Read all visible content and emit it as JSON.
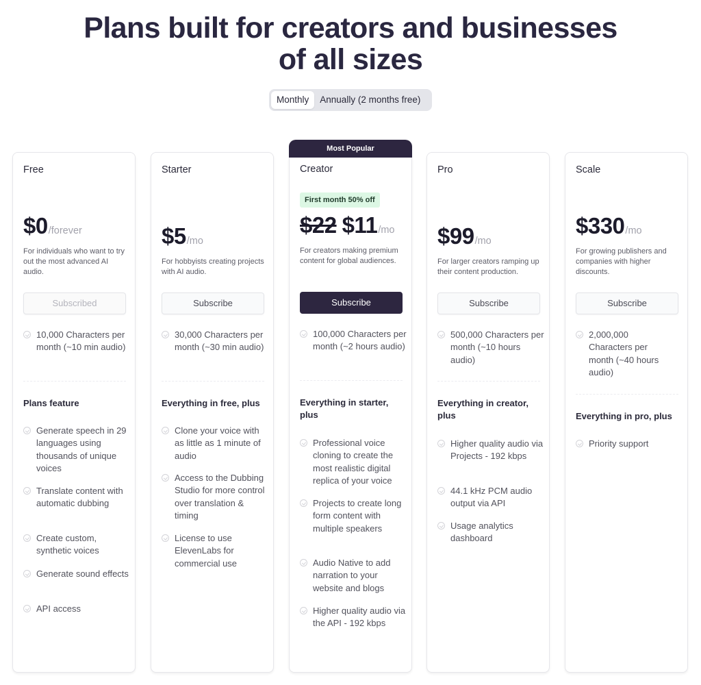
{
  "header": {
    "title_line1": "Plans built for creators and businesses",
    "title_line2": "of all sizes"
  },
  "billing_toggle": {
    "options": [
      "Monthly",
      "Annually (2 months free)"
    ],
    "selected": "Monthly"
  },
  "colors": {
    "primary_dark": "#2d2640",
    "promo_green_bg": "#dcf7e4",
    "title": "#2a2740"
  },
  "plans": [
    {
      "name": "Free",
      "price": "$0",
      "unit": "/forever",
      "description": "For individuals who want to try out the most advanced AI audio.",
      "button": "Subscribed",
      "quota": "10,000 Characters per month (~10 min audio)",
      "section_title": "Plans feature",
      "features": [
        "Generate speech in 29 languages using thousands of unique voices",
        "Translate content with automatic dubbing",
        "Create custom, synthetic voices",
        "Generate sound effects",
        "API access"
      ]
    },
    {
      "name": "Starter",
      "price": "$5",
      "unit": "/mo",
      "description": "For hobbyists creating projects with AI audio.",
      "button": "Subscribe",
      "quota": "30,000 Characters per month (~30 min audio)",
      "section_title": "Everything in free, plus",
      "features": [
        "Clone your voice with as little as 1 minute of audio",
        "Access to the Dubbing Studio for more control over translation & timing",
        "License to use ElevenLabs for commercial use"
      ]
    },
    {
      "name": "Creator",
      "banner": "Most Popular",
      "promo": "First month 50% off",
      "old_price": "$22",
      "price": "$11",
      "unit": "/mo",
      "description": "For creators making premium content for global audiences.",
      "button": "Subscribe",
      "quota": "100,000 Characters per month (~2 hours audio)",
      "section_title": "Everything in starter, plus",
      "features": [
        "Professional voice cloning to create the most realistic digital replica of your voice",
        "Projects to create long form content with multiple speakers",
        "Audio Native to add narration to your website and blogs",
        "Higher quality audio via the API - 192 kbps"
      ]
    },
    {
      "name": "Pro",
      "price": "$99",
      "unit": "/mo",
      "description": "For larger creators ramping up their content production.",
      "button": "Subscribe",
      "quota": "500,000 Characters per month (~10 hours audio)",
      "section_title": "Everything in creator, plus",
      "features": [
        "Higher quality audio via Projects - 192 kbps",
        "44.1 kHz PCM audio output via API",
        "Usage analytics dashboard"
      ]
    },
    {
      "name": "Scale",
      "price": "$330",
      "unit": "/mo",
      "description": "For growing publishers and companies with higher discounts.",
      "button": "Subscribe",
      "quota": "2,000,000 Characters per month (~40 hours audio)",
      "section_title": "Everything in pro, plus",
      "features": [
        "Priority support"
      ]
    }
  ]
}
